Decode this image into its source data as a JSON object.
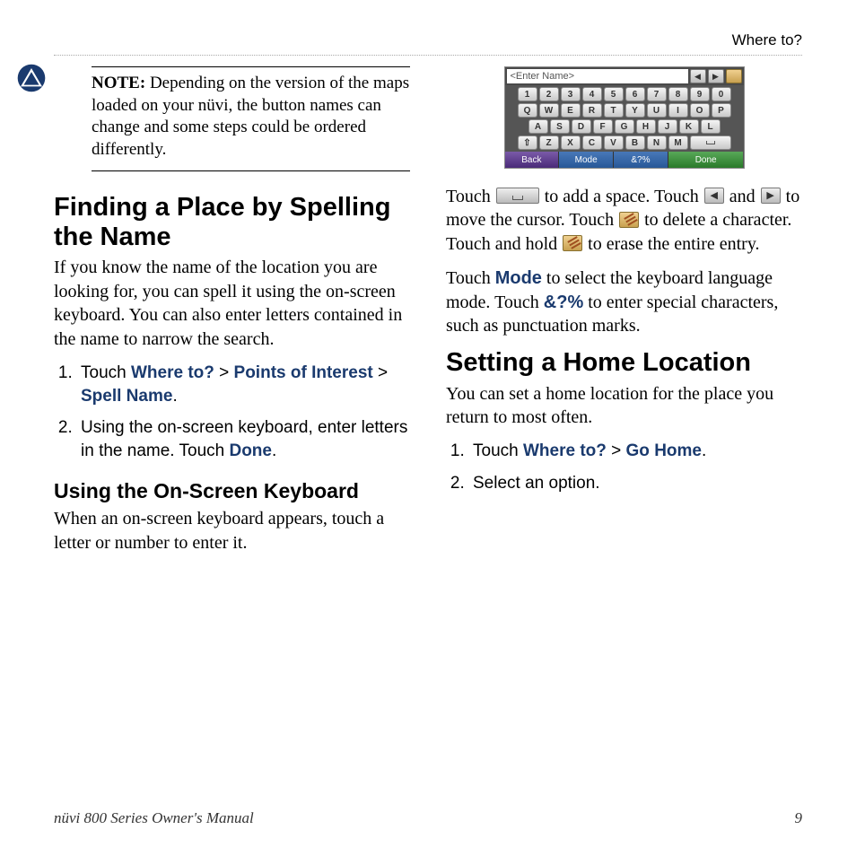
{
  "header": {
    "breadcrumb": "Where to?"
  },
  "note": {
    "label": "NOTE:",
    "text": "Depending on the version of the maps loaded on your nüvi, the button names can change and some steps could be ordered differently."
  },
  "section1": {
    "title": "Finding a Place by Spelling the Name",
    "intro": "If you know the name of the location you are looking for, you can spell it using the on-screen keyboard. You can also enter letters contained in the name to narrow the search.",
    "steps": {
      "s1_prefix": "Touch ",
      "s1_a": "Where to?",
      "s1_sep1": " > ",
      "s1_b": "Points of Interest",
      "s1_sep2": " > ",
      "s1_c": "Spell Name",
      "s1_suffix": ".",
      "s2_prefix": "Using the on-screen keyboard, enter letters in the name. Touch ",
      "s2_a": "Done",
      "s2_suffix": "."
    },
    "sub": {
      "title": "Using the On-Screen Keyboard",
      "text": "When an on-screen keyboard appears, touch a letter or number to enter it."
    }
  },
  "keyboard": {
    "placeholder": "<Enter Name>",
    "row1": [
      "1",
      "2",
      "3",
      "4",
      "5",
      "6",
      "7",
      "8",
      "9",
      "0"
    ],
    "row2": [
      "Q",
      "W",
      "E",
      "R",
      "T",
      "Y",
      "U",
      "I",
      "O",
      "P"
    ],
    "row3": [
      "A",
      "S",
      "D",
      "F",
      "G",
      "H",
      "J",
      "K",
      "L"
    ],
    "row4": [
      "⇧",
      "Z",
      "X",
      "C",
      "V",
      "B",
      "N",
      "M"
    ],
    "back": "Back",
    "mode": "Mode",
    "sym": "&?%",
    "done": "Done"
  },
  "kb_help": {
    "p1_a": "Touch ",
    "p1_b": " to add a space. Touch ",
    "p1_c": " and ",
    "p1_d": " to move the cursor. Touch ",
    "p1_e": " to delete a character. Touch and hold ",
    "p1_f": " to erase the entire entry.",
    "p2_a": "Touch ",
    "p2_mode": "Mode",
    "p2_b": " to select the keyboard language mode. Touch ",
    "p2_sym": "&?%",
    "p2_c": " to enter special characters, such as punctuation marks."
  },
  "section2": {
    "title": "Setting a Home Location",
    "intro": "You can set a home location for the place you return to most often.",
    "steps": {
      "s1_prefix": "Touch ",
      "s1_a": "Where to?",
      "s1_sep": " > ",
      "s1_b": "Go Home",
      "s1_suffix": ".",
      "s2": "Select an option."
    }
  },
  "footer": {
    "left": "nüvi 800 Series Owner's Manual",
    "right": "9"
  }
}
